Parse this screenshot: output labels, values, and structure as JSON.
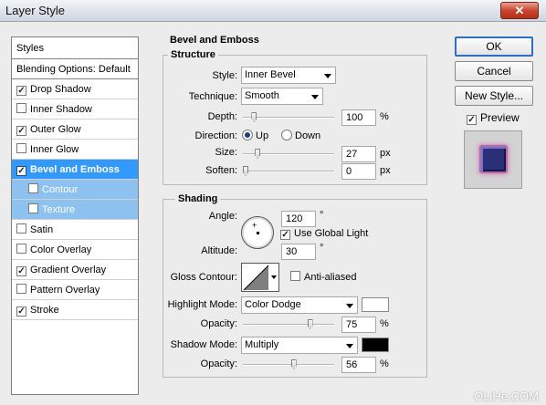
{
  "window": {
    "title": "Layer Style",
    "close_glyph": "✕"
  },
  "styles_list": {
    "header": "Styles",
    "blending": "Blending Options: Default",
    "items": [
      {
        "label": "Drop Shadow",
        "checked": true
      },
      {
        "label": "Inner Shadow",
        "checked": false
      },
      {
        "label": "Outer Glow",
        "checked": true
      },
      {
        "label": "Inner Glow",
        "checked": false
      },
      {
        "label": "Bevel and Emboss",
        "checked": true,
        "selected": true
      },
      {
        "label": "Contour",
        "checked": false,
        "sub": true
      },
      {
        "label": "Texture",
        "checked": false,
        "sub": true
      },
      {
        "label": "Satin",
        "checked": false
      },
      {
        "label": "Color Overlay",
        "checked": false
      },
      {
        "label": "Gradient Overlay",
        "checked": true
      },
      {
        "label": "Pattern Overlay",
        "checked": false
      },
      {
        "label": "Stroke",
        "checked": true
      }
    ]
  },
  "buttons": {
    "ok": "OK",
    "cancel": "Cancel",
    "new_style": "New Style..."
  },
  "preview": {
    "label": "Preview",
    "checked": true
  },
  "bevel": {
    "title": "Bevel and Emboss",
    "structure": {
      "title": "Structure",
      "style_label": "Style:",
      "style_value": "Inner Bevel",
      "technique_label": "Technique:",
      "technique_value": "Smooth",
      "depth_label": "Depth:",
      "depth_value": "100",
      "depth_unit": "%",
      "depth_slider": 0.1,
      "direction_label": "Direction:",
      "direction_up": "Up",
      "direction_down": "Down",
      "direction_selected": "Up",
      "size_label": "Size:",
      "size_value": "27",
      "size_unit": "px",
      "size_slider": 0.14,
      "soften_label": "Soften:",
      "soften_value": "0",
      "soften_unit": "px",
      "soften_slider": 0.0
    },
    "shading": {
      "title": "Shading",
      "angle_label": "Angle:",
      "angle_value": "120",
      "angle_unit": "°",
      "global_light_label": "Use Global Light",
      "global_light_checked": true,
      "altitude_label": "Altitude:",
      "altitude_value": "30",
      "altitude_unit": "°",
      "gloss_label": "Gloss Contour:",
      "anti_aliased_label": "Anti-aliased",
      "anti_aliased_checked": false,
      "highlight_mode_label": "Highlight Mode:",
      "highlight_mode_value": "Color Dodge",
      "highlight_color": "#ffffff",
      "highlight_opacity_label": "Opacity:",
      "highlight_opacity_value": "75",
      "highlight_opacity_unit": "%",
      "highlight_slider": 0.75,
      "shadow_mode_label": "Shadow Mode:",
      "shadow_mode_value": "Multiply",
      "shadow_color": "#000000",
      "shadow_opacity_label": "Opacity:",
      "shadow_opacity_value": "56",
      "shadow_opacity_unit": "%",
      "shadow_slider": 0.56
    }
  },
  "watermark": "OLiHe.COM",
  "colors": {
    "selected_row": "#3399ff",
    "sub_row": "#8dc1f0",
    "preview_fill": "#2a2f78",
    "preview_glow": "#d37fc0"
  }
}
